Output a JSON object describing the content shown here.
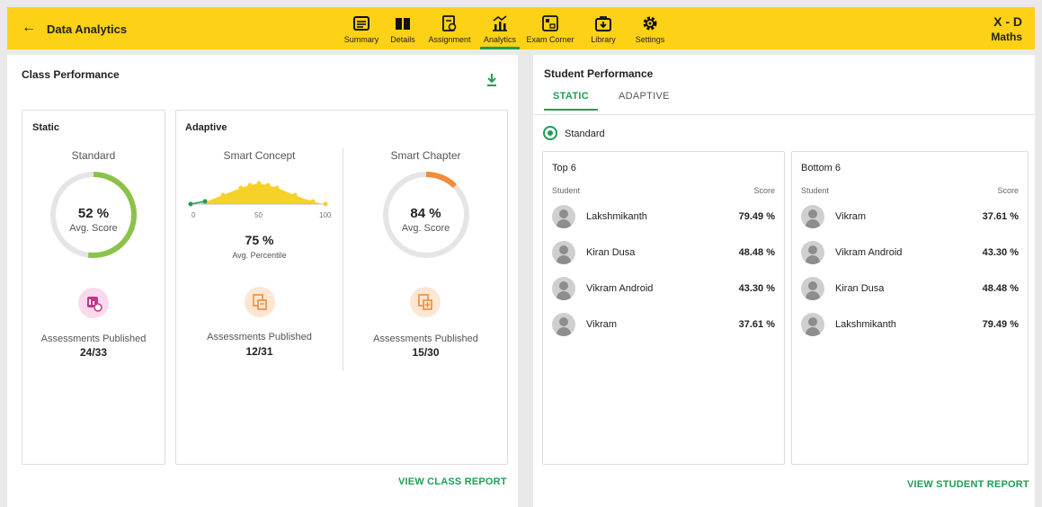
{
  "header": {
    "title": "Data Analytics",
    "class_name": "X - D",
    "subject": "Maths",
    "nav": [
      {
        "label": "Summary",
        "icon": "summary-icon"
      },
      {
        "label": "Details",
        "icon": "book-icon"
      },
      {
        "label": "Assignment",
        "icon": "assignment-icon"
      },
      {
        "label": "Analytics",
        "icon": "analytics-icon",
        "active": true
      },
      {
        "label": "Exam Corner",
        "icon": "exam-corner-icon"
      },
      {
        "label": "Library",
        "icon": "library-icon"
      },
      {
        "label": "Settings",
        "icon": "gear-icon"
      }
    ]
  },
  "class_performance": {
    "title": "Class Performance",
    "static": {
      "title": "Static",
      "subtitle": "Standard",
      "score": "52 %",
      "score_value": 52,
      "score_label": "Avg. Score",
      "published_label": "Assessments Published",
      "published_value": "24/33"
    },
    "adaptive": {
      "title": "Adaptive",
      "smart_concept": {
        "title": "Smart Concept",
        "axis": [
          "0",
          "50",
          "100"
        ],
        "percentile": "75 %",
        "percentile_label": "Avg. Percentile",
        "published_label": "Assessments Published",
        "published_value": "12/31"
      },
      "smart_chapter": {
        "title": "Smart Chapter",
        "score": "84 %",
        "score_value": 84,
        "score_label": "Avg. Score",
        "published_label": "Assessments Published",
        "published_value": "15/30"
      }
    },
    "report_link": "VIEW CLASS REPORT"
  },
  "student_performance": {
    "title": "Student Performance",
    "tabs": [
      "STATIC",
      "ADAPTIVE"
    ],
    "radio_label": "Standard",
    "top": {
      "title": "Top 6",
      "col_student": "Student",
      "col_score": "Score",
      "rows": [
        {
          "name": "Lakshmikanth",
          "score": "79.49 %"
        },
        {
          "name": "Kiran Dusa",
          "score": "48.48 %"
        },
        {
          "name": "Vikram Android",
          "score": "43.30 %"
        },
        {
          "name": "Vikram",
          "score": "37.61 %"
        }
      ]
    },
    "bottom": {
      "title": "Bottom 6",
      "col_student": "Student",
      "col_score": "Score",
      "rows": [
        {
          "name": "Vikram",
          "score": "37.61 %"
        },
        {
          "name": "Vikram Android",
          "score": "43.30 %"
        },
        {
          "name": "Kiran Dusa",
          "score": "48.48 %"
        },
        {
          "name": "Lakshmikanth",
          "score": "79.49 %"
        }
      ]
    },
    "report_link": "VIEW STUDENT REPORT"
  },
  "colors": {
    "header_bg": "#fcd116",
    "accent": "#1f9d55",
    "static_ring": "#8bc34a",
    "chapter_ring": "#f08c3a",
    "curve": "#f6d12a"
  }
}
